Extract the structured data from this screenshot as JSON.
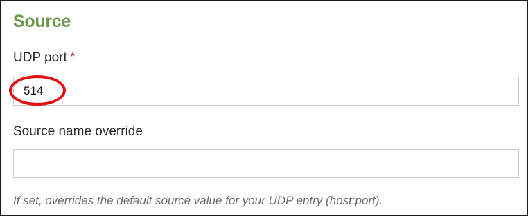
{
  "section": {
    "title": "Source"
  },
  "udp_port": {
    "label": "UDP port",
    "required_marker": "*",
    "value": "514",
    "highlight_color": "#e01010"
  },
  "source_name_override": {
    "label": "Source name override",
    "value": "",
    "help": "If set, overrides the default source value for your UDP entry (host:port)."
  },
  "colors": {
    "title_green": "#6b9a4f",
    "required_red": "#b03030"
  }
}
